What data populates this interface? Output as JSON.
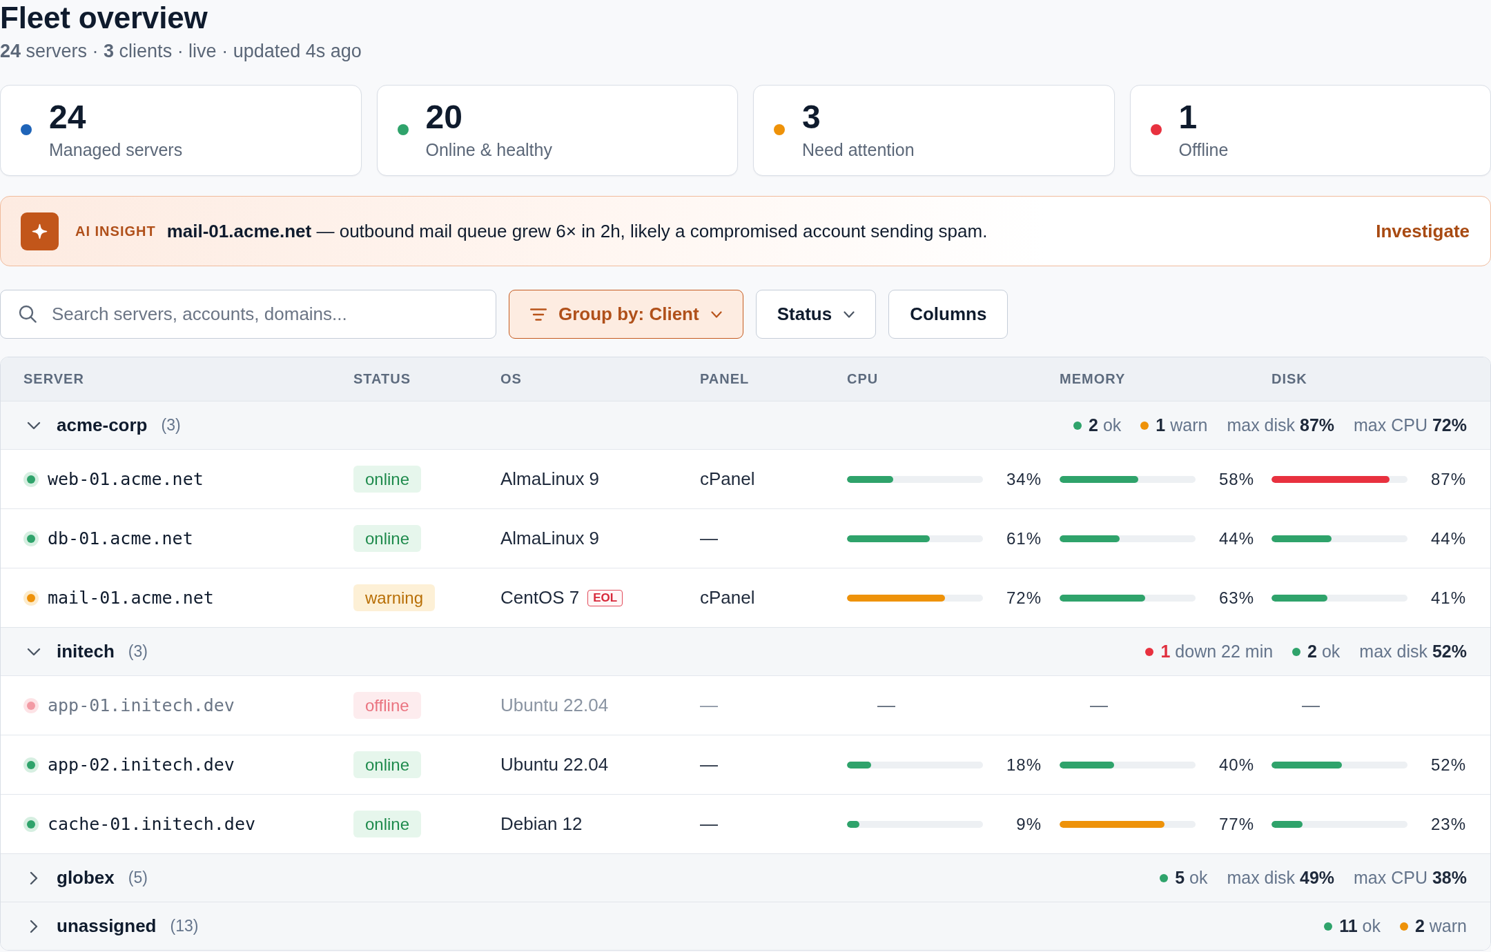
{
  "header": {
    "title": "Fleet overview",
    "subtitle": "**24** servers · **3** clients · live · updated 4s ago"
  },
  "stats": [
    {
      "value": "24",
      "label": "Managed servers",
      "color": "#1f64b8"
    },
    {
      "value": "20",
      "label": "Online & healthy",
      "color": "#2fa36b"
    },
    {
      "value": "3",
      "label": "Need attention",
      "color": "#ee9209"
    },
    {
      "value": "1",
      "label": "Offline",
      "color": "#e8313f"
    }
  ],
  "insight": {
    "tag": "AI INSIGHT",
    "message": "**mail-01.acme.net** — outbound mail queue grew 6× in 2h, likely a compromised account sending spam.",
    "action": "Investigate"
  },
  "toolbar": {
    "search": {
      "placeholder": "Search servers, accounts, domains..."
    },
    "buttons": [
      {
        "label": "Group by: Client",
        "kind": "group",
        "active": true
      },
      {
        "label": "Status",
        "kind": "menu",
        "active": false
      },
      {
        "label": "Columns",
        "kind": "plain",
        "active": false
      }
    ]
  },
  "table": {
    "columns": [
      "SERVER",
      "STATUS",
      "OS",
      "PANEL",
      "CPU",
      "MEMORY",
      "DISK"
    ],
    "groups": [
      {
        "name": "acme-corp",
        "count": "(3)",
        "expanded": true,
        "summary": [
          {
            "kind": "status",
            "color": "#2fa36b",
            "count": "2",
            "label": "ok",
            "alert": false
          },
          {
            "kind": "status",
            "color": "#ee9209",
            "count": "1",
            "label": "warn",
            "alert": false
          },
          {
            "kind": "metric",
            "label": "max disk",
            "value": "87%"
          },
          {
            "kind": "metric",
            "label": "max CPU",
            "value": "72%"
          }
        ],
        "servers": [
          {
            "name": "web-01.acme.net",
            "kind": "ok",
            "status": "online",
            "os": "AlmaLinux 9",
            "panel": "cPanel",
            "metrics": [
              {
                "level": 0.34,
                "reading": "34%",
                "color": "#2fa36b"
              },
              {
                "level": 0.58,
                "reading": "58%",
                "color": "#2fa36b"
              },
              {
                "level": 0.87,
                "reading": "87%",
                "color": "#e8313f"
              }
            ]
          },
          {
            "name": "db-01.acme.net",
            "kind": "ok",
            "status": "online",
            "os": "AlmaLinux 9",
            "panel": "—",
            "metrics": [
              {
                "level": 0.61,
                "reading": "61%",
                "color": "#2fa36b"
              },
              {
                "level": 0.44,
                "reading": "44%",
                "color": "#2fa36b"
              },
              {
                "level": 0.44,
                "reading": "44%",
                "color": "#2fa36b"
              }
            ]
          },
          {
            "name": "mail-01.acme.net",
            "kind": "warn",
            "status": "warning",
            "os": "CentOS 7",
            "badge": "EOL",
            "panel": "cPanel",
            "metrics": [
              {
                "level": 0.72,
                "reading": "72%",
                "color": "#ee9209"
              },
              {
                "level": 0.63,
                "reading": "63%",
                "color": "#2fa36b"
              },
              {
                "level": 0.41,
                "reading": "41%",
                "color": "#2fa36b"
              }
            ]
          }
        ]
      },
      {
        "name": "initech",
        "count": "(3)",
        "expanded": true,
        "summary": [
          {
            "kind": "status",
            "color": "#e8313f",
            "count": "1",
            "label": "down 22 min",
            "alert": true
          },
          {
            "kind": "status",
            "color": "#2fa36b",
            "count": "2",
            "label": "ok",
            "alert": false
          },
          {
            "kind": "metric",
            "label": "max disk",
            "value": "52%"
          }
        ],
        "servers": [
          {
            "name": "app-01.initech.dev",
            "kind": "down",
            "status": "offline",
            "os": "Ubuntu 22.04",
            "panel": "—",
            "metrics": [
              {
                "reading": "—"
              },
              {
                "reading": "—"
              },
              {
                "reading": "—"
              }
            ]
          },
          {
            "name": "app-02.initech.dev",
            "kind": "ok",
            "status": "online",
            "os": "Ubuntu 22.04",
            "panel": "—",
            "metrics": [
              {
                "level": 0.18,
                "reading": "18%",
                "color": "#2fa36b"
              },
              {
                "level": 0.4,
                "reading": "40%",
                "color": "#2fa36b"
              },
              {
                "level": 0.52,
                "reading": "52%",
                "color": "#2fa36b"
              }
            ]
          },
          {
            "name": "cache-01.initech.dev",
            "kind": "ok",
            "status": "online",
            "os": "Debian 12",
            "panel": "—",
            "metrics": [
              {
                "level": 0.09,
                "reading": "9%",
                "color": "#2fa36b"
              },
              {
                "level": 0.77,
                "reading": "77%",
                "color": "#ee9209"
              },
              {
                "level": 0.23,
                "reading": "23%",
                "color": "#2fa36b"
              }
            ]
          }
        ]
      },
      {
        "name": "globex",
        "count": "(5)",
        "expanded": false,
        "summary": [
          {
            "kind": "status",
            "color": "#2fa36b",
            "count": "5",
            "label": "ok",
            "alert": false
          },
          {
            "kind": "metric",
            "label": "max disk",
            "value": "49%"
          },
          {
            "kind": "metric",
            "label": "max CPU",
            "value": "38%"
          }
        ]
      },
      {
        "name": "unassigned",
        "count": "(13)",
        "expanded": false,
        "summary": [
          {
            "kind": "status",
            "color": "#2fa36b",
            "count": "11",
            "label": "ok",
            "alert": false
          },
          {
            "kind": "status",
            "color": "#ee9209",
            "count": "2",
            "label": "warn",
            "alert": false
          }
        ]
      }
    ]
  }
}
